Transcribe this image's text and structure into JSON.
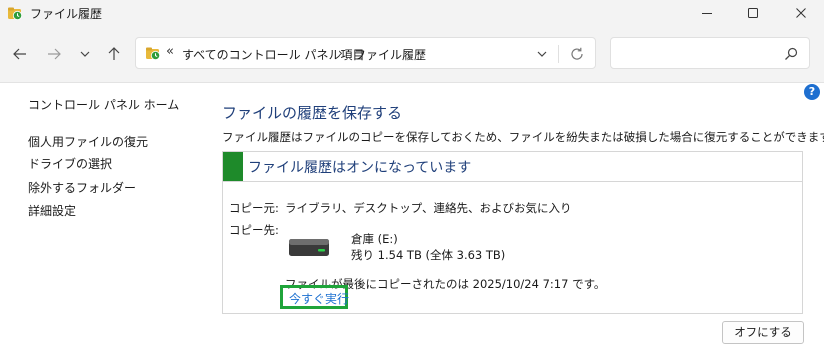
{
  "window": {
    "title": "ファイル履歴",
    "min_glyph": "—",
    "max_glyph": "☐",
    "close_glyph": "✕"
  },
  "nav": {
    "back_glyph": "←",
    "forward_glyph": "→",
    "recent_glyph": "⌄",
    "up_glyph": "↑"
  },
  "address": {
    "overflow": "«",
    "crumbs": [
      "すべてのコントロール パネル項目",
      "ファイル履歴"
    ],
    "separator": "›"
  },
  "search": {
    "placeholder": ""
  },
  "help": {
    "glyph": "?"
  },
  "sidebar": {
    "items": [
      {
        "label": "コントロール パネル ホーム"
      },
      {
        "label": "個人用ファイルの復元"
      },
      {
        "label": "ドライブの選択"
      },
      {
        "label": "除外するフォルダー"
      },
      {
        "label": "詳細設定"
      }
    ]
  },
  "main": {
    "title": "ファイルの履歴を保存する",
    "description": "ファイル履歴はファイルのコピーを保存しておくため、ファイルを紛失または破損した場合に復元することができます。",
    "status": "ファイル履歴はオンになっています",
    "copy_from_label": "コピー元:",
    "copy_from_value": "ライブラリ、デスクトップ、連絡先、およびお気に入り",
    "copy_to_label": "コピー先:",
    "drive_name": "倉庫 (E:)",
    "drive_space": "残り 1.54 TB (全体 3.63 TB)",
    "last_copied": "ファイルが最後にコピーされたのは 2025/10/24 7:17 です。",
    "run_now": "今すぐ実行",
    "turn_off": "オフにする"
  },
  "colors": {
    "accent_green": "#1e8a2a",
    "highlight_green": "#1fa43a",
    "link_blue": "#1a6fd0",
    "heading_blue": "#1f3f7a"
  }
}
